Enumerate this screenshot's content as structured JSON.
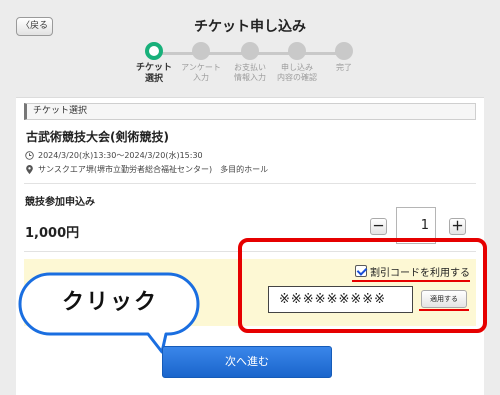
{
  "header": {
    "back_label": "〈戻る",
    "title": "チケット申し込み"
  },
  "stepper": {
    "steps": [
      {
        "label": "チケット\n選択",
        "active": true
      },
      {
        "label": "アンケート\n入力",
        "active": false
      },
      {
        "label": "お支払い\n情報入力",
        "active": false
      },
      {
        "label": "申し込み\n内容の確認",
        "active": false
      },
      {
        "label": "完了",
        "active": false
      }
    ]
  },
  "ticket_section": {
    "header": "チケット選択",
    "event_title": "古武術競技大会(剣術競技)",
    "datetime": "2024/3/20(水)13:30～2024/3/20(水)15:30",
    "venue": "サンスクエア堺(堺市立勤労者総合福祉センター)　多目的ホール",
    "ticket_name": "競技参加申込み",
    "price": "1,000円",
    "quantity": "1",
    "minus_label": "－",
    "plus_label": "＋"
  },
  "coupon": {
    "checkbox_label": "割引コードを利用する",
    "checked": true,
    "code_value": "※※※※※※※※※",
    "apply_label": "適用する"
  },
  "annotation": {
    "bubble_text": "クリック"
  },
  "footer": {
    "next_label": "次へ進む"
  },
  "colors": {
    "accent_green": "#18b07a",
    "highlight_red": "#e60000",
    "primary_blue": "#1a65cc",
    "coupon_band": "#fdf8d4"
  }
}
